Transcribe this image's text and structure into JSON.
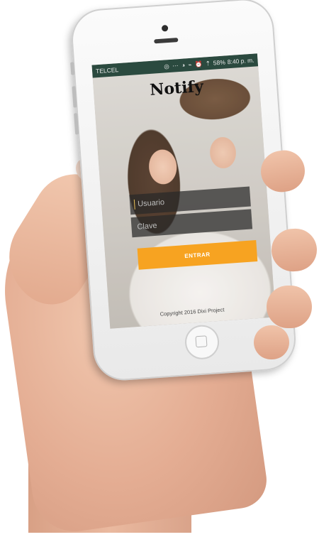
{
  "status_bar": {
    "carrier": "TELCEL",
    "icons": "◎ ⋯ ◑ ⌁ ⏰ ⇡",
    "battery": "58%",
    "time": "8:40 p. m."
  },
  "app": {
    "title": "Notify"
  },
  "login": {
    "username_placeholder": "Usuario",
    "password_placeholder": "Clave",
    "submit_label": "ENTRAR"
  },
  "footer": {
    "copyright": "Copyright 2016 Dixi Project"
  },
  "colors": {
    "accent": "#f7a321",
    "status_bar": "#2b4a3f",
    "field_bg": "#282828"
  }
}
